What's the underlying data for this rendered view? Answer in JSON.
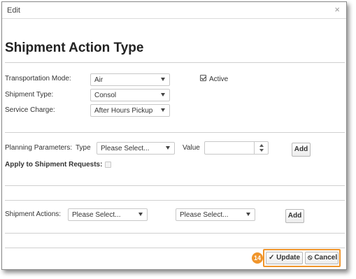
{
  "dialog": {
    "title": "Edit",
    "close_glyph": "×"
  },
  "heading": "Shipment Action Type",
  "fields": {
    "transportation_mode": {
      "label": "Transportation Mode:",
      "value": "Air"
    },
    "shipment_type": {
      "label": "Shipment Type:",
      "value": "Consol"
    },
    "service_charge": {
      "label": "Service Charge:",
      "value": "After Hours Pickup"
    },
    "active": {
      "label": "Active",
      "checked": true
    }
  },
  "planning": {
    "label": "Planning Parameters:",
    "type_label": "Type",
    "type_value": "Please Select...",
    "value_label": "Value",
    "value_input": "",
    "add_label": "Add",
    "apply_label": "Apply to Shipment Requests:",
    "apply_checked": false
  },
  "shipment_actions": {
    "label": "Shipment Actions:",
    "select1": "Please Select...",
    "select2": "Please Select...",
    "add_label": "Add"
  },
  "footer": {
    "badge": "14",
    "update_label": "Update",
    "cancel_label": "Cancel",
    "update_icon": "✓",
    "cancel_icon": "⦸"
  },
  "colors": {
    "highlight": "#f0952b"
  },
  "icons": {
    "close": "close-icon",
    "dropdown": "chevron-down-icon",
    "update": "check-icon",
    "cancel": "cancel-icon"
  }
}
